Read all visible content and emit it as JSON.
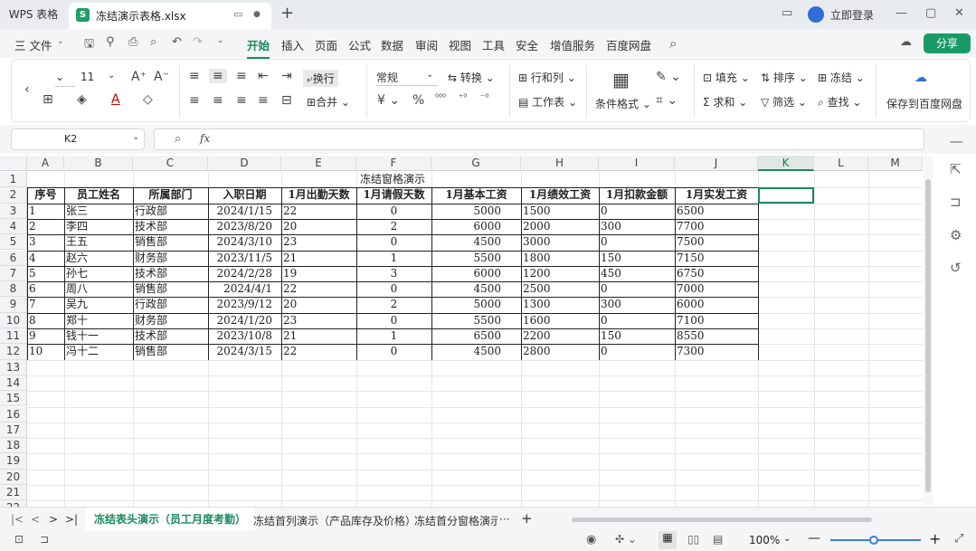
{
  "titlebar": {
    "app_tab": "WPS 表格",
    "file_tab": "冻结演示表格.xlsx",
    "login": "立即登录"
  },
  "menubar": {
    "file": "三 文件",
    "items": [
      "开始",
      "插入",
      "页面",
      "公式",
      "数据",
      "审阅",
      "视图",
      "工具",
      "安全",
      "增值服务",
      "百度网盘"
    ],
    "active": "开始",
    "share": "分享"
  },
  "ribbon": {
    "font_size": "11",
    "wrap": "换行",
    "merge": "合并",
    "format": "常规",
    "convert": "转换",
    "rowcol": "行和列",
    "worksheet": "工作表",
    "cond_format": "条件格式",
    "fill": "填充",
    "sort": "排序",
    "freeze": "冻结",
    "sum": "求和",
    "filter": "筛选",
    "find": "查找",
    "save_baidu": "保存到百度网盘"
  },
  "formula_bar": {
    "cell_ref": "K2",
    "fx": "fx",
    "value": ""
  },
  "sheet": {
    "columns": [
      "A",
      "B",
      "C",
      "D",
      "E",
      "F",
      "G",
      "H",
      "I",
      "J",
      "K",
      "L",
      "M"
    ],
    "selected_col": "K",
    "rows": [
      "1",
      "2",
      "3",
      "4",
      "5",
      "6",
      "7",
      "8",
      "9",
      "10",
      "11",
      "12",
      "13",
      "14",
      "15",
      "16",
      "17",
      "18",
      "19",
      "20",
      "21",
      "22"
    ],
    "title": "冻结窗格演示",
    "headers": [
      "序号",
      "员工姓名",
      "所属部门",
      "入职日期",
      "1月出勤天数",
      "1月请假天数",
      "1月基本工资",
      "1月绩效工资",
      "1月扣款金额",
      "1月实发工资"
    ],
    "data": [
      [
        "1",
        "张三",
        "行政部",
        "2024/1/15",
        "22",
        "0",
        "5000",
        "1500",
        "0",
        "6500"
      ],
      [
        "2",
        "李四",
        "技术部",
        "2023/8/20",
        "20",
        "2",
        "6000",
        "2000",
        "300",
        "7700"
      ],
      [
        "3",
        "王五",
        "销售部",
        "2024/3/10",
        "23",
        "0",
        "4500",
        "3000",
        "0",
        "7500"
      ],
      [
        "4",
        "赵六",
        "财务部",
        "2023/11/5",
        "21",
        "1",
        "5500",
        "1800",
        "150",
        "7150"
      ],
      [
        "5",
        "孙七",
        "技术部",
        "2024/2/28",
        "19",
        "3",
        "6000",
        "1200",
        "450",
        "6750"
      ],
      [
        "6",
        "周八",
        "销售部",
        "2024/4/1",
        "22",
        "0",
        "4500",
        "2500",
        "0",
        "7000"
      ],
      [
        "7",
        "吴九",
        "行政部",
        "2023/9/12",
        "20",
        "2",
        "5000",
        "1300",
        "300",
        "6000"
      ],
      [
        "8",
        "郑十",
        "财务部",
        "2024/1/20",
        "23",
        "0",
        "5500",
        "1600",
        "0",
        "7100"
      ],
      [
        "9",
        "钱十一",
        "技术部",
        "2023/10/8",
        "21",
        "1",
        "6500",
        "2200",
        "150",
        "8550"
      ],
      [
        "10",
        "冯十二",
        "销售部",
        "2024/3/15",
        "22",
        "0",
        "4500",
        "2800",
        "0",
        "7300"
      ]
    ]
  },
  "sheet_tabs": {
    "tabs": [
      "冻结表头演示（员工月度考勤）",
      "冻结首列演示（产品库存及价格）",
      "冻结首分窗格演示"
    ],
    "active": 0
  },
  "status": {
    "zoom": "100%"
  }
}
